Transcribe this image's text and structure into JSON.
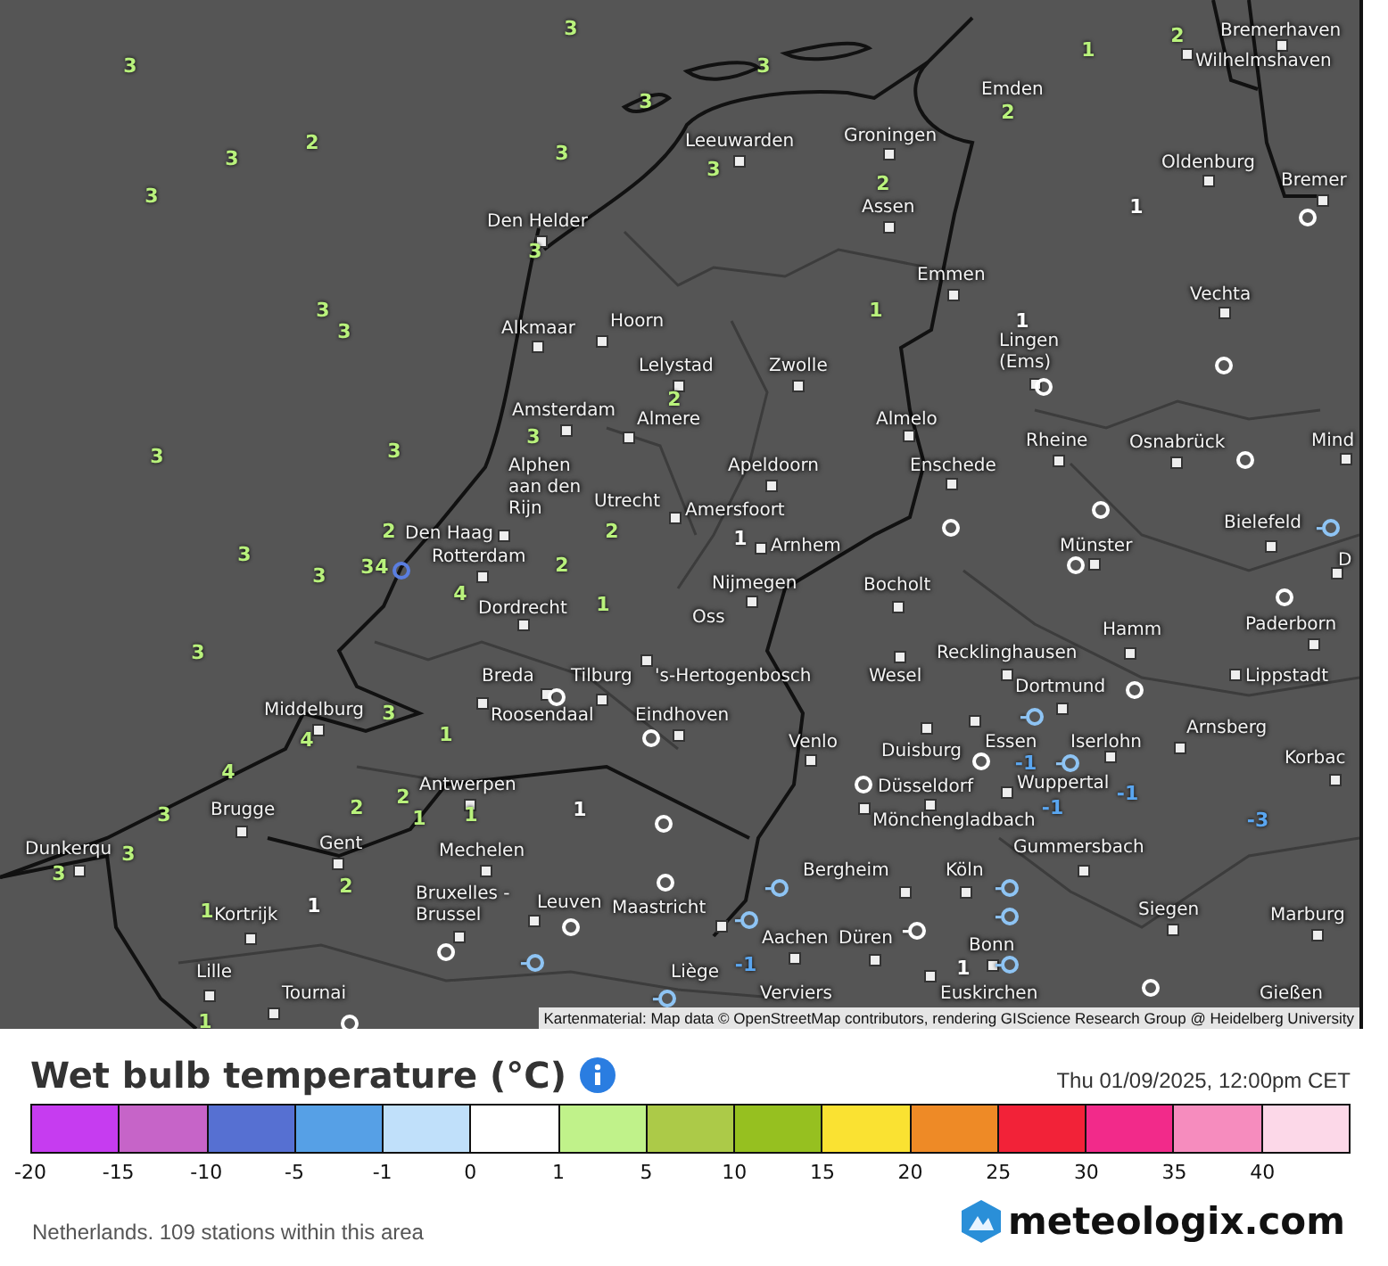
{
  "map": {
    "cities": [
      {
        "name": "Bremerhaven"
      },
      {
        "name": "Wilhelmshaven"
      },
      {
        "name": "Emden"
      },
      {
        "name": "Groningen"
      },
      {
        "name": "Leeuwarden"
      },
      {
        "name": "Oldenburg"
      },
      {
        "name": "Bremer"
      },
      {
        "name": "Assen"
      },
      {
        "name": "Den Helder"
      },
      {
        "name": "Emmen"
      },
      {
        "name": "Vechta"
      },
      {
        "name": "Hoorn"
      },
      {
        "name": "Alkmaar"
      },
      {
        "name": "Lelystad"
      },
      {
        "name": "Zwolle"
      },
      {
        "name": "Lingen (Ems)"
      },
      {
        "name": "Amsterdam"
      },
      {
        "name": "Almere"
      },
      {
        "name": "Almelo"
      },
      {
        "name": "Rheine"
      },
      {
        "name": "Osnabrück"
      },
      {
        "name": "Mind"
      },
      {
        "name": "Alphen aan den Rijn"
      },
      {
        "name": "Apeldoorn"
      },
      {
        "name": "Enschede"
      },
      {
        "name": "Utrecht"
      },
      {
        "name": "Amersfoort"
      },
      {
        "name": "Den Haag"
      },
      {
        "name": "Bielefeld"
      },
      {
        "name": "Rotterdam"
      },
      {
        "name": "Arnhem"
      },
      {
        "name": "Münster"
      },
      {
        "name": "D"
      },
      {
        "name": "Nijmegen"
      },
      {
        "name": "Bocholt"
      },
      {
        "name": "Dordrecht"
      },
      {
        "name": "Oss"
      },
      {
        "name": "Hamm"
      },
      {
        "name": "Paderborn"
      },
      {
        "name": "Recklinghausen"
      },
      {
        "name": "Breda"
      },
      {
        "name": "Tilburg"
      },
      {
        "name": "'s-Hertogenbosch"
      },
      {
        "name": "Wesel"
      },
      {
        "name": "Dortmund"
      },
      {
        "name": "Lippstadt"
      },
      {
        "name": "Middelburg"
      },
      {
        "name": "Roosendaal"
      },
      {
        "name": "Eindhoven"
      },
      {
        "name": "Venlo"
      },
      {
        "name": "Duisburg"
      },
      {
        "name": "Essen"
      },
      {
        "name": "Iserlohn"
      },
      {
        "name": "Arnsberg"
      },
      {
        "name": "Korbac"
      },
      {
        "name": "Antwerpen"
      },
      {
        "name": "Düsseldorf"
      },
      {
        "name": "Wuppertal"
      },
      {
        "name": "Brugge"
      },
      {
        "name": "Mönchengladbach"
      },
      {
        "name": "Dunkerqu"
      },
      {
        "name": "Gent"
      },
      {
        "name": "Mechelen"
      },
      {
        "name": "Gummersbach"
      },
      {
        "name": "Bergheim"
      },
      {
        "name": "Köln"
      },
      {
        "name": "Kortrijk"
      },
      {
        "name": "Bruxelles - Brussel"
      },
      {
        "name": "Leuven"
      },
      {
        "name": "Maastricht"
      },
      {
        "name": "Siegen"
      },
      {
        "name": "Marburg"
      },
      {
        "name": "Aachen"
      },
      {
        "name": "Düren"
      },
      {
        "name": "Bonn"
      },
      {
        "name": "Lille"
      },
      {
        "name": "Liège"
      },
      {
        "name": "Tournai"
      },
      {
        "name": "Verviers"
      },
      {
        "name": "Euskirchen"
      },
      {
        "name": "Gießen"
      }
    ],
    "stations": [
      {
        "kind": "value",
        "value": "3",
        "color": "#b9f27c"
      },
      {
        "kind": "value",
        "value": "2",
        "color": "#b9f27c"
      },
      {
        "kind": "value",
        "value": "1",
        "color": "#b9f27c"
      },
      {
        "kind": "value",
        "value": "3",
        "color": "#b9f27c"
      },
      {
        "kind": "value",
        "value": "3",
        "color": "#b9f27c"
      },
      {
        "kind": "value",
        "value": "3",
        "color": "#b9f27c"
      },
      {
        "kind": "value",
        "value": "2",
        "color": "#b9f27c"
      },
      {
        "kind": "value",
        "value": "3",
        "color": "#b9f27c"
      },
      {
        "kind": "value",
        "value": "2",
        "color": "#b9f27c"
      },
      {
        "kind": "value",
        "value": "3",
        "color": "#b9f27c"
      },
      {
        "kind": "value",
        "value": "3",
        "color": "#b9f27c"
      },
      {
        "kind": "value",
        "value": "3",
        "color": "#b9f27c"
      },
      {
        "kind": "value",
        "value": "2",
        "color": "#b9f27c"
      },
      {
        "kind": "value",
        "value": "1",
        "color": "#ffffff"
      },
      {
        "kind": "ring",
        "color": "#ffffff"
      },
      {
        "kind": "value",
        "value": "3",
        "color": "#b9f27c"
      },
      {
        "kind": "value",
        "value": "3",
        "color": "#b9f27c"
      },
      {
        "kind": "value",
        "value": "3",
        "color": "#b9f27c"
      },
      {
        "kind": "value",
        "value": "1",
        "color": "#b9f27c"
      },
      {
        "kind": "value",
        "value": "1",
        "color": "#ffffff"
      },
      {
        "kind": "ring",
        "color": "#ffffff"
      },
      {
        "kind": "ring",
        "color": "#ffffff"
      },
      {
        "kind": "value",
        "value": "2",
        "color": "#b9f27c"
      },
      {
        "kind": "value",
        "value": "3",
        "color": "#b9f27c"
      },
      {
        "kind": "value",
        "value": "3",
        "color": "#b9f27c"
      },
      {
        "kind": "value",
        "value": "3",
        "color": "#b9f27c"
      },
      {
        "kind": "ring",
        "color": "#ffffff"
      },
      {
        "kind": "ring",
        "color": "#ffffff"
      },
      {
        "kind": "value",
        "value": "2",
        "color": "#b9f27c"
      },
      {
        "kind": "value",
        "value": "2",
        "color": "#b9f27c"
      },
      {
        "kind": "value",
        "value": "1",
        "color": "#ffffff"
      },
      {
        "kind": "ring",
        "color": "#ffffff"
      },
      {
        "kind": "ring",
        "color": "#8ec4f4",
        "value": "-"
      },
      {
        "kind": "value",
        "value": "3",
        "color": "#b9f27c"
      },
      {
        "kind": "value",
        "value": "3",
        "color": "#b9f27c"
      },
      {
        "kind": "value",
        "value": "3",
        "color": "#b9f27c"
      },
      {
        "kind": "value",
        "value": "4",
        "color": "#b9f27c"
      },
      {
        "kind": "ring",
        "color": "#5a7ee0"
      },
      {
        "kind": "value",
        "value": "2",
        "color": "#b9f27c"
      },
      {
        "kind": "ring",
        "color": "#ffffff"
      },
      {
        "kind": "value",
        "value": "4",
        "color": "#b9f27c"
      },
      {
        "kind": "value",
        "value": "1",
        "color": "#b9f27c"
      },
      {
        "kind": "value",
        "value": "3",
        "color": "#b9f27c"
      },
      {
        "kind": "ring",
        "color": "#ffffff"
      },
      {
        "kind": "ring",
        "color": "#ffffff"
      },
      {
        "kind": "ring",
        "color": "#ffffff"
      },
      {
        "kind": "value",
        "value": "3",
        "color": "#b9f27c"
      },
      {
        "kind": "ring",
        "color": "#8ec4f4",
        "value": "-"
      },
      {
        "kind": "value",
        "value": "4",
        "color": "#b9f27c"
      },
      {
        "kind": "value",
        "value": "1",
        "color": "#b9f27c"
      },
      {
        "kind": "ring",
        "color": "#ffffff"
      },
      {
        "kind": "ring",
        "color": "#ffffff"
      },
      {
        "kind": "value",
        "value": "-1",
        "color": "#5aa6f0"
      },
      {
        "kind": "ring",
        "color": "#8ec4f4",
        "value": "-"
      },
      {
        "kind": "value",
        "value": "4",
        "color": "#b9f27c"
      },
      {
        "kind": "ring",
        "color": "#ffffff"
      },
      {
        "kind": "value",
        "value": "2",
        "color": "#b9f27c"
      },
      {
        "kind": "value",
        "value": "-1",
        "color": "#5aa6f0"
      },
      {
        "kind": "value",
        "value": "3",
        "color": "#b9f27c"
      },
      {
        "kind": "value",
        "value": "2",
        "color": "#b9f27c"
      },
      {
        "kind": "value",
        "value": "1",
        "color": "#b9f27c"
      },
      {
        "kind": "value",
        "value": "1",
        "color": "#b9f27c"
      },
      {
        "kind": "value",
        "value": "1",
        "color": "#ffffff"
      },
      {
        "kind": "ring",
        "color": "#ffffff"
      },
      {
        "kind": "value",
        "value": "-1",
        "color": "#5aa6f0"
      },
      {
        "kind": "value",
        "value": "-3",
        "color": "#5aa6f0"
      },
      {
        "kind": "value",
        "value": "3",
        "color": "#b9f27c"
      },
      {
        "kind": "value",
        "value": "3",
        "color": "#b9f27c"
      },
      {
        "kind": "value",
        "value": "2",
        "color": "#b9f27c"
      },
      {
        "kind": "ring",
        "color": "#ffffff"
      },
      {
        "kind": "ring",
        "color": "#8ec4f4",
        "value": "-"
      },
      {
        "kind": "ring",
        "color": "#8ec4f4",
        "value": "-"
      },
      {
        "kind": "value",
        "value": "1",
        "color": "#b9f27c"
      },
      {
        "kind": "value",
        "value": "1",
        "color": "#ffffff"
      },
      {
        "kind": "ring",
        "color": "#ffffff"
      },
      {
        "kind": "ring",
        "color": "#8ec4f4",
        "value": "-"
      },
      {
        "kind": "ring",
        "color": "#ffffff",
        "value": "-"
      },
      {
        "kind": "ring",
        "color": "#8ec4f4",
        "value": "-"
      },
      {
        "kind": "ring",
        "color": "#ffffff"
      },
      {
        "kind": "ring",
        "color": "#8ec4f4",
        "value": "-"
      },
      {
        "kind": "value",
        "value": "-1",
        "color": "#5aa6f0"
      },
      {
        "kind": "value",
        "value": "1",
        "color": "#ffffff"
      },
      {
        "kind": "ring",
        "color": "#8ec4f4",
        "value": "-"
      },
      {
        "kind": "ring",
        "color": "#ffffff"
      },
      {
        "kind": "ring",
        "color": "#8ec4f4",
        "value": "-"
      },
      {
        "kind": "value",
        "value": "1",
        "color": "#b9f27c"
      },
      {
        "kind": "ring",
        "color": "#ffffff"
      }
    ],
    "attribution": "Kartenmaterial: Map data © OpenStreetMap contributors, rendering GIScience Research Group @ Heidelberg University"
  },
  "legend": {
    "title": "Wet bulb temperature (°C)",
    "timestamp": "Thu 01/09/2025, 12:00pm CET",
    "swatches": [
      {
        "color": "#c63cf0"
      },
      {
        "color": "#c664c8"
      },
      {
        "color": "#5670d2"
      },
      {
        "color": "#56a0e6"
      },
      {
        "color": "#c0e0fa"
      },
      {
        "color": "#ffffff"
      },
      {
        "color": "#c0f28a"
      },
      {
        "color": "#acca48"
      },
      {
        "color": "#96c020"
      },
      {
        "color": "#fae232"
      },
      {
        "color": "#ee8a26"
      },
      {
        "color": "#f22238"
      },
      {
        "color": "#f22a8a"
      },
      {
        "color": "#f68cbe"
      },
      {
        "color": "#fcd8e8"
      }
    ],
    "ticks": [
      "-20",
      "-15",
      "-10",
      "-5",
      "-1",
      "0",
      "1",
      "5",
      "10",
      "15",
      "20",
      "25",
      "30",
      "35",
      "40"
    ]
  },
  "footer": {
    "note": "Netherlands. 109 stations within this area",
    "brand": "meteologix.com"
  }
}
